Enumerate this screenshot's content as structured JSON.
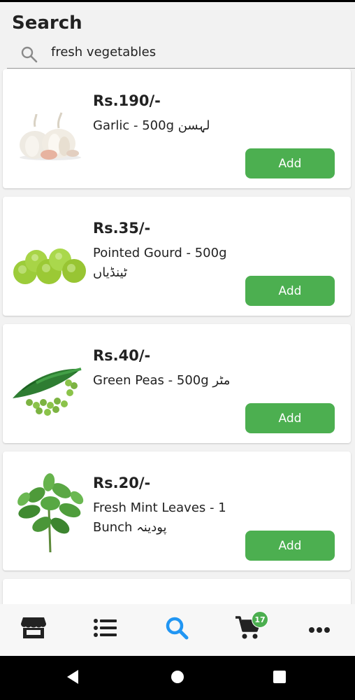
{
  "header": {
    "title": "Search",
    "search": {
      "value": "fresh vegetables",
      "placeholder": ""
    }
  },
  "products": [
    {
      "price": "Rs.190/-",
      "name": "Garlic - 500g",
      "urdu": "لہسن",
      "add_label": "Add",
      "image": "garlic-image"
    },
    {
      "price": "Rs.35/-",
      "name": "Pointed Gourd - 500g",
      "urdu": "ٹینڈیاں",
      "add_label": "Add",
      "image": "pointed-gourd-image"
    },
    {
      "price": "Rs.40/-",
      "name": "Green Peas - 500g",
      "urdu": "مٹر",
      "add_label": "Add",
      "image": "green-peas-image"
    },
    {
      "price": "Rs.20/-",
      "name": "Fresh Mint Leaves - 1 Bunch",
      "urdu": "پودینہ",
      "add_label": "Add",
      "image": "mint-leaves-image"
    }
  ],
  "bottom_nav": {
    "items": [
      "store-icon",
      "list-icon",
      "search-icon",
      "cart-icon",
      "more-icon"
    ],
    "active": "search-icon",
    "cart_count": "17"
  },
  "colors": {
    "accent": "#4caf50",
    "active_nav": "#2196f3",
    "nav_icon": "#222222",
    "text": "#222222"
  }
}
